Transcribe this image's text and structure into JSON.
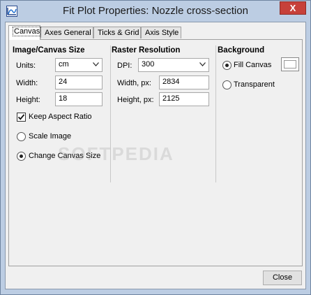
{
  "window": {
    "title": "Fit Plot Properties: Nozzle cross-section",
    "close_glyph": "X"
  },
  "tabs": [
    {
      "label": "Canvas",
      "active": true
    },
    {
      "label": "Axes General",
      "active": false
    },
    {
      "label": "Ticks & Grid",
      "active": false
    },
    {
      "label": "Axis Style",
      "active": false
    }
  ],
  "image_canvas": {
    "title": "Image/Canvas Size",
    "units_label": "Units:",
    "units_value": "cm",
    "width_label": "Width:",
    "width_value": "24",
    "height_label": "Height:",
    "height_value": "18",
    "keep_aspect_label": "Keep Aspect Ratio",
    "keep_aspect_checked": true,
    "scale_image_label": "Scale Image",
    "scale_image_selected": false,
    "change_canvas_label": "Change Canvas Size",
    "change_canvas_selected": true
  },
  "raster": {
    "title": "Raster Resolution",
    "dpi_label": "DPI:",
    "dpi_value": "300",
    "width_px_label": "Width, px:",
    "width_px_value": "2834",
    "height_px_label": "Height, px:",
    "height_px_value": "2125"
  },
  "background": {
    "title": "Background",
    "fill_label": "Fill Canvas",
    "fill_selected": true,
    "transparent_label": "Transparent",
    "transparent_selected": false,
    "fill_color": "#ffffff"
  },
  "watermark": "SOFTPEDIA",
  "footer": {
    "close_label": "Close"
  }
}
